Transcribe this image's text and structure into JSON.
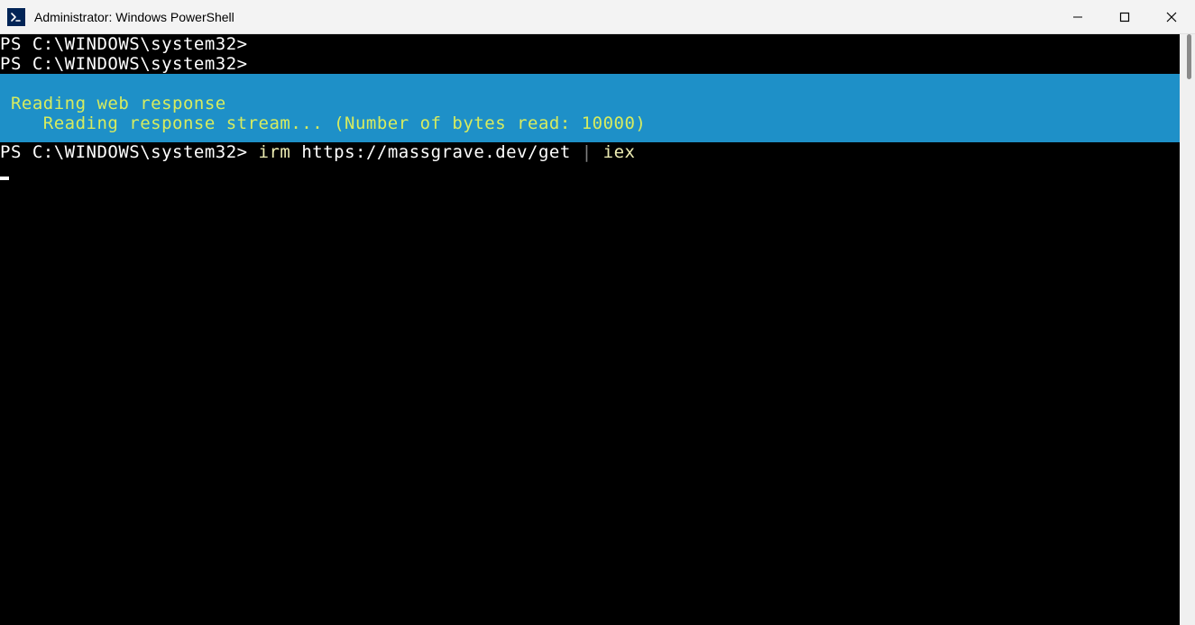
{
  "window": {
    "title": "Administrator: Windows PowerShell"
  },
  "terminal": {
    "prompt1": "PS C:\\WINDOWS\\system32>",
    "prompt2": "PS C:\\WINDOWS\\system32>",
    "progress": {
      "line1": " Reading web response",
      "line2": "    Reading response stream... (Number of bytes read: 10000)"
    },
    "cmd": {
      "prompt": "PS C:\\WINDOWS\\system32> ",
      "part1": "irm ",
      "url": "https://massgrave.dev/get ",
      "pipe": "| ",
      "part2": "iex"
    }
  }
}
